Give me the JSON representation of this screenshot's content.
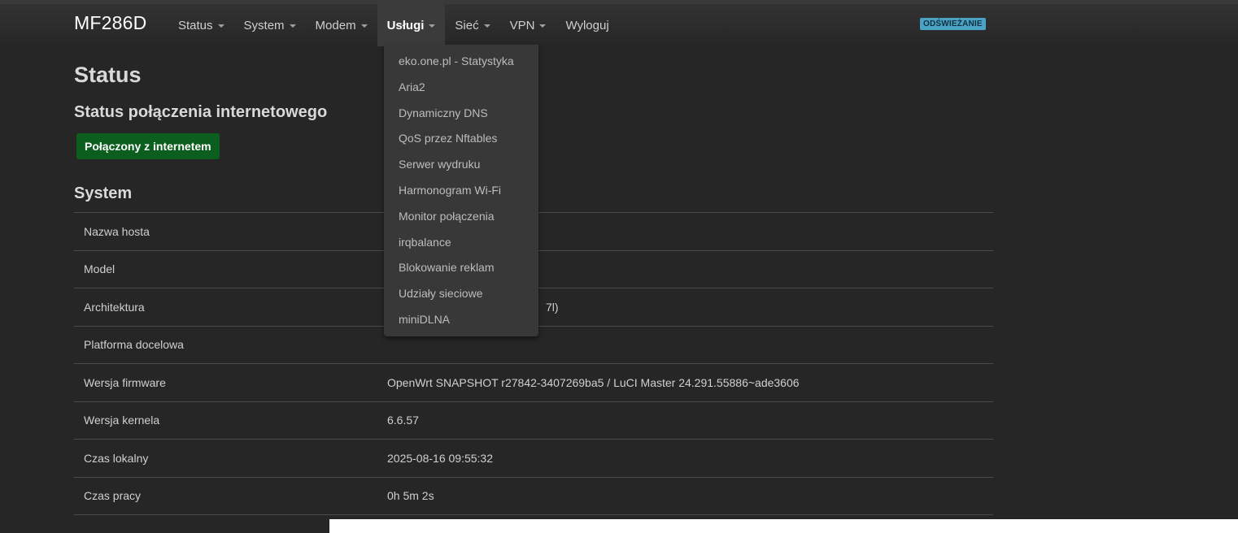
{
  "header": {
    "brand": "MF286D",
    "nav": [
      {
        "label": "Status",
        "caret": true
      },
      {
        "label": "System",
        "caret": true
      },
      {
        "label": "Modem",
        "caret": true
      },
      {
        "label": "Usługi",
        "caret": true,
        "active": true
      },
      {
        "label": "Sieć",
        "caret": true
      },
      {
        "label": "VPN",
        "caret": true
      },
      {
        "label": "Wyloguj",
        "caret": false
      }
    ],
    "refresh_badge": "ODŚWIEŻANIE"
  },
  "dropdown": {
    "items": [
      "eko.one.pl - Statystyka",
      "Aria2",
      "Dynamiczny DNS",
      "QoS przez Nftables",
      "Serwer wydruku",
      "Harmonogram Wi-Fi",
      "Monitor połączenia",
      "irqbalance",
      "Blokowanie reklam",
      "Udziały sieciowe",
      "miniDLNA"
    ]
  },
  "main": {
    "page_title": "Status",
    "internet_status_title": "Status połączenia internetowego",
    "connection_badge": "Połączony z internetem",
    "system_title": "System",
    "system_rows": [
      {
        "key": "Nazwa hosta",
        "value": ""
      },
      {
        "key": "Model",
        "value": ""
      },
      {
        "key": "Architektura",
        "value": "7l)"
      },
      {
        "key": "Platforma docelowa",
        "value": ""
      },
      {
        "key": "Wersja firmware",
        "value": "OpenWrt SNAPSHOT r27842-3407269ba5 / LuCI Master 24.291.55886~ade3606"
      },
      {
        "key": "Wersja kernela",
        "value": "6.6.57"
      },
      {
        "key": "Czas lokalny",
        "value": "2025-08-16 09:55:32"
      },
      {
        "key": "Czas pracy",
        "value": "0h 5m 2s"
      }
    ]
  },
  "colors": {
    "background": "#262626",
    "connected_badge": "#0c5e1e",
    "refresh_badge": "#4aa3c4",
    "dropdown_bg": "#383838"
  }
}
